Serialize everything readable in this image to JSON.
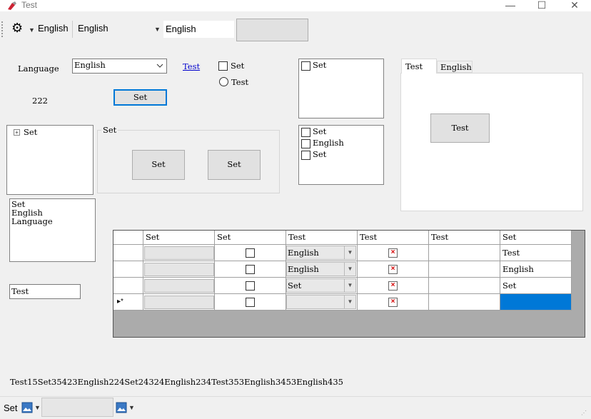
{
  "window": {
    "title": "Test"
  },
  "toolstrip": {
    "dropdown_label": "English",
    "combo_value": "English",
    "textbox_value": "English"
  },
  "form": {
    "language_label": "Language",
    "language_combo": "English",
    "link_text": "Test",
    "checkbox_label": "Set",
    "radio_label": "Test",
    "number_label": "222",
    "set_button": "Set",
    "groupbox_title": "Set",
    "group_btn1": "Set",
    "group_btn2": "Set",
    "tree_root": "Set",
    "textarea_lines": [
      "Set",
      "English",
      "Language"
    ],
    "textbox_value": "Test",
    "listbox_items": [
      "Set"
    ],
    "checked_list": [
      "Set",
      "English",
      "Set"
    ],
    "tabs": [
      "Test",
      "English"
    ],
    "tab_button": "Test"
  },
  "grid": {
    "headers": [
      "Set",
      "Set",
      "Test",
      "Test",
      "Test",
      "Set"
    ],
    "rows": [
      {
        "combo": "English",
        "text": "Test"
      },
      {
        "combo": "English",
        "text": "English"
      },
      {
        "combo": "Set",
        "text": "Set"
      },
      {
        "combo": "",
        "text": ""
      }
    ],
    "new_row_marker": "▸*"
  },
  "label_long": "Test15Set35423English224Set24324English234Test353English3453English435",
  "statusbar": {
    "label": "Set"
  }
}
